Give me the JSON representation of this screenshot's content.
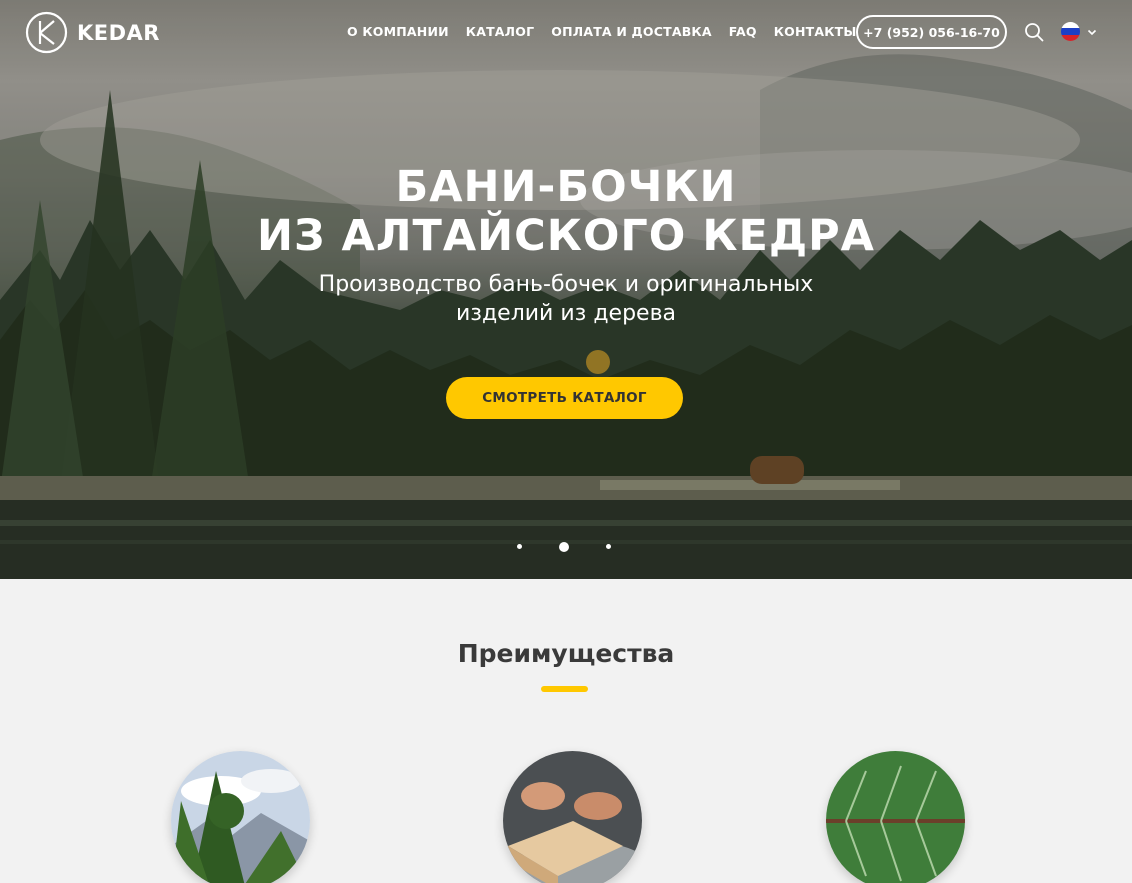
{
  "header": {
    "logo_text": "KEDAR",
    "nav": [
      "О КОМПАНИИ",
      "КАТАЛОГ",
      "ОПЛАТА И ДОСТАВКА",
      "FAQ",
      "КОНТАКТЫ"
    ],
    "phone": "+7 (952) 056-16-70",
    "search_icon": "search-icon",
    "language_flag": "russia-flag-icon"
  },
  "hero": {
    "title_line1": "БАНИ-БОЧКИ",
    "title_line2": "ИЗ АЛТАЙСКОГО КЕДРА",
    "subtitle_line1": "Производство бань-бочек и оригинальных",
    "subtitle_line2": "изделий из дерева",
    "cta_label": "СМОТРЕТЬ КАТАЛОГ",
    "slides_count": 3,
    "active_slide": 2
  },
  "advantages": {
    "title": "Преимущества",
    "images": [
      "cedar-forest-image",
      "woodworking-image",
      "green-leaf-image"
    ]
  },
  "colors": {
    "accent": "#ffc800",
    "text_dark": "#3a3a3a",
    "section_bg": "#f2f2f2"
  }
}
